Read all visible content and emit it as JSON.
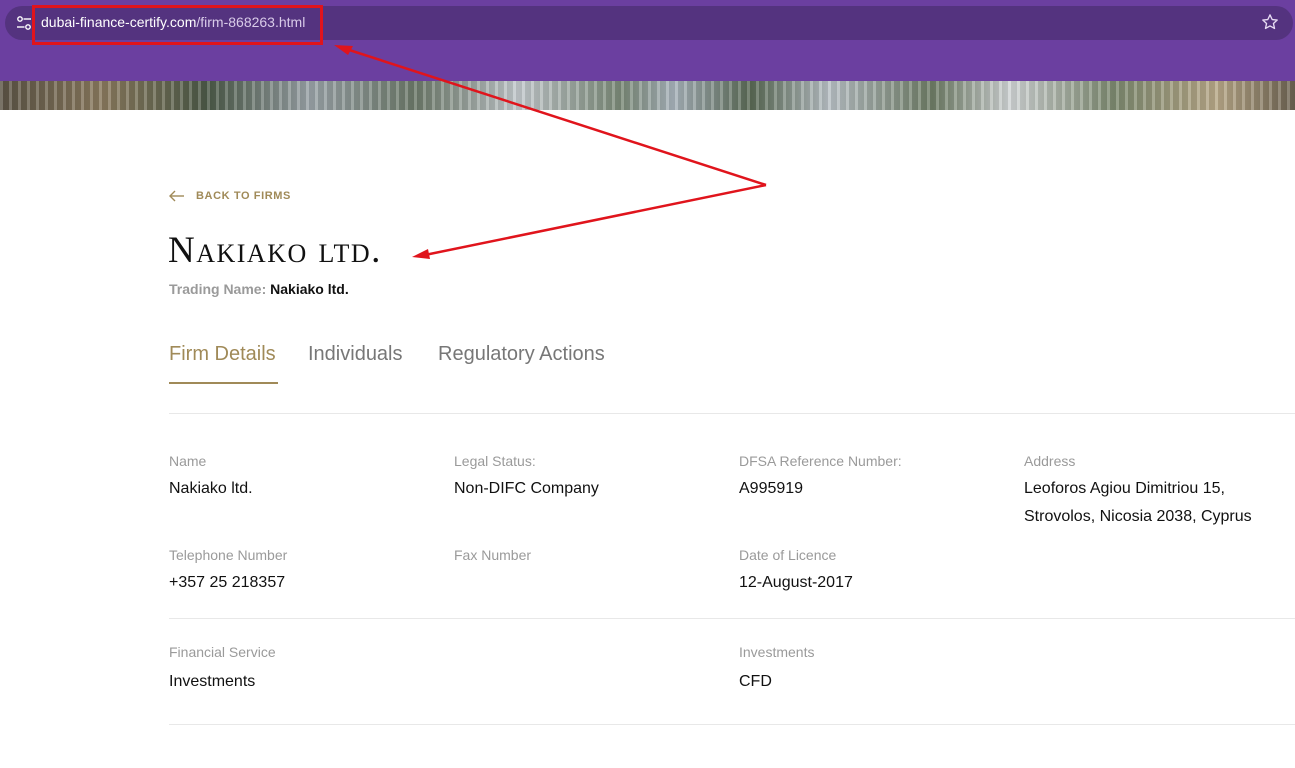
{
  "browser": {
    "url_domain": "dubai-finance-certify.com",
    "url_path": "/firm-868263.html"
  },
  "page": {
    "back_link": "BACK TO FIRMS",
    "firm_title": "Nakiako ltd.",
    "trading_name_label": "Trading Name:",
    "trading_name_value": "Nakiako ltd."
  },
  "tabs": [
    {
      "label": "Firm Details",
      "active": true
    },
    {
      "label": "Individuals",
      "active": false
    },
    {
      "label": "Regulatory Actions",
      "active": false
    }
  ],
  "details": {
    "name": {
      "label": "Name",
      "value": "Nakiako ltd."
    },
    "legal_status": {
      "label": "Legal Status:",
      "value": "Non-DIFC Company"
    },
    "dfsa_ref": {
      "label": "DFSA Reference Number:",
      "value": "A995919"
    },
    "address": {
      "label": "Address",
      "line1": "Leoforos Agiou Dimitriou 15,",
      "line2": "Strovolos, Nicosia 2038, Cyprus"
    },
    "telephone": {
      "label": "Telephone Number",
      "value": "+357 25 218357"
    },
    "fax": {
      "label": "Fax Number",
      "value": ""
    },
    "licence_date": {
      "label": "Date of Licence",
      "value": "12-August-2017"
    },
    "financial_service": {
      "label": "Financial Service",
      "value": "Investments"
    },
    "investments": {
      "label": "Investments",
      "value": "CFD"
    }
  },
  "colors": {
    "browser_purple": "#6b3fa0",
    "accent_gold": "#a08a58",
    "annotation_red": "#e0141c"
  }
}
